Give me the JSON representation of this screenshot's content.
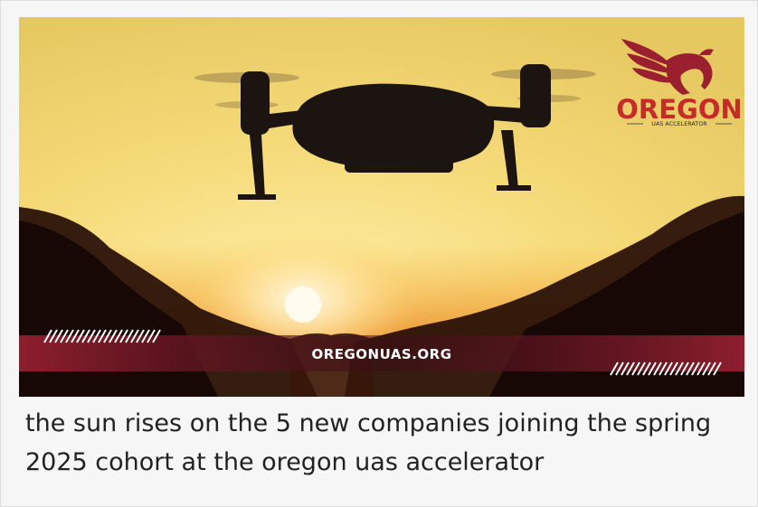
{
  "post": {
    "image": {
      "banner_url": "OREGONUAS.ORG",
      "logo": {
        "word": "OREGON",
        "subtitle": "UAS ACCELERATOR"
      },
      "colors": {
        "sky_top": "#f6dd7c",
        "sun": "#fff6d6",
        "banner": "#8e1e2e",
        "logo_word": "#c72a2a",
        "logo_mark": "#9a1f2f",
        "logo_sub": "#2b2b2b"
      }
    },
    "caption": "the sun rises on the 5 new companies joining the spring 2025 cohort at the oregon uas accelerator"
  }
}
